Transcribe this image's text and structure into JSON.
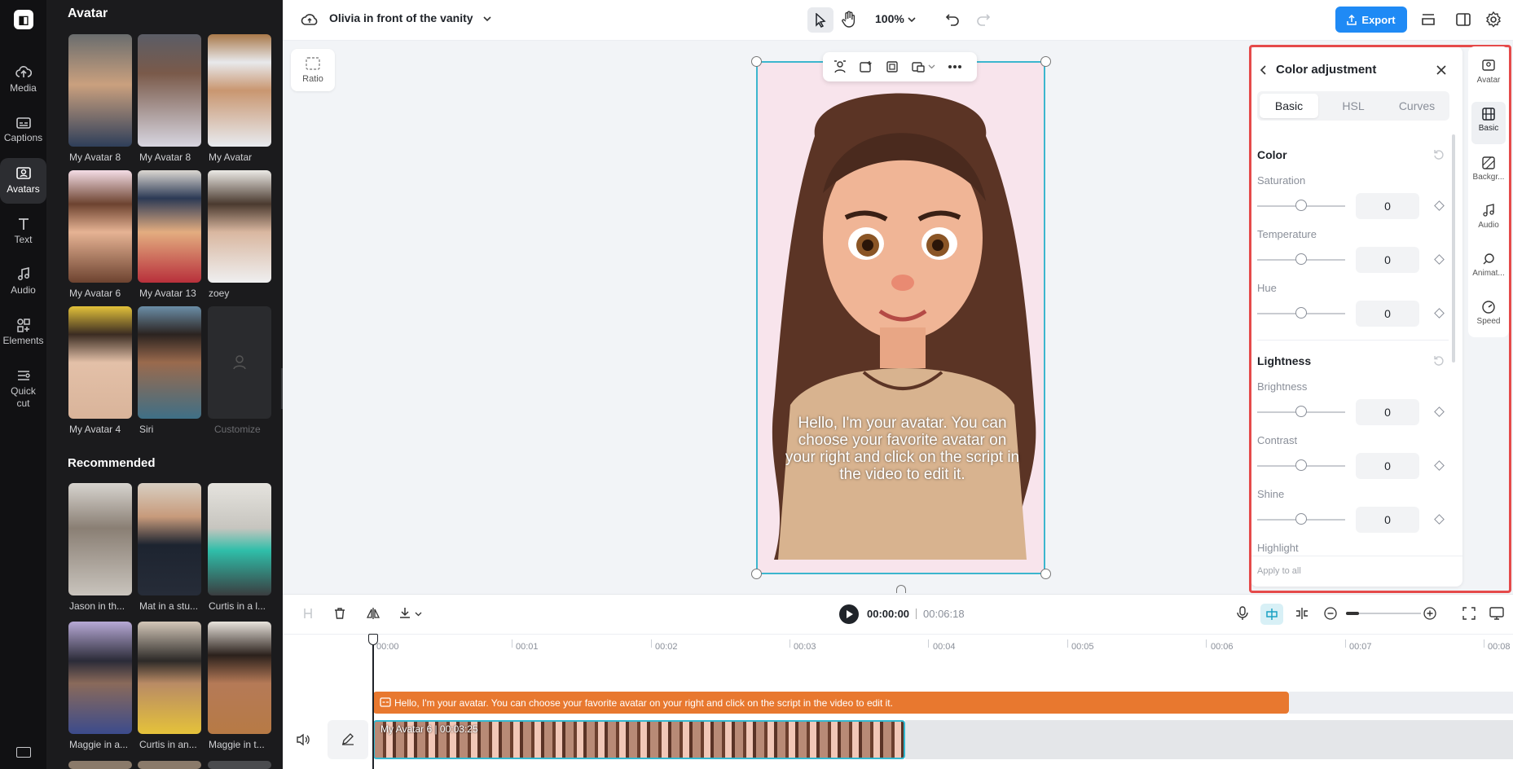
{
  "nav": {
    "items": [
      {
        "label": "Media"
      },
      {
        "label": "Captions"
      },
      {
        "label": "Avatars"
      },
      {
        "label": "Text"
      },
      {
        "label": "Audio"
      },
      {
        "label": "Elements"
      },
      {
        "label": "Quick cut"
      }
    ]
  },
  "panel": {
    "title": "Avatar",
    "avatars": [
      {
        "name": "My Avatar 8"
      },
      {
        "name": "My Avatar 8"
      },
      {
        "name": "My Avatar"
      },
      {
        "name": "My Avatar 6"
      },
      {
        "name": "My Avatar 13"
      },
      {
        "name": "zoey"
      },
      {
        "name": "My Avatar 4"
      },
      {
        "name": "Siri"
      },
      {
        "name": "Customize"
      }
    ],
    "recommended_title": "Recommended",
    "recommended": [
      {
        "name": "Jason in th..."
      },
      {
        "name": "Mat in a stu..."
      },
      {
        "name": "Curtis in a l..."
      },
      {
        "name": "Maggie in a..."
      },
      {
        "name": "Curtis in an..."
      },
      {
        "name": "Maggie in t..."
      }
    ]
  },
  "topbar": {
    "project_title": "Olivia in front of the vanity",
    "zoom": "100%",
    "export_label": "Export"
  },
  "canvas": {
    "ratio_label": "Ratio",
    "caption": "Hello, I'm your avatar. You can choose your favorite avatar on your right and click on the script in the video to edit it."
  },
  "color_panel": {
    "title": "Color adjustment",
    "tabs": [
      "Basic",
      "HSL",
      "Curves"
    ],
    "color_section": "Color",
    "saturation_label": "Saturation",
    "saturation_value": "0",
    "temperature_label": "Temperature",
    "temperature_value": "0",
    "hue_label": "Hue",
    "hue_value": "0",
    "lightness_section": "Lightness",
    "brightness_label": "Brightness",
    "brightness_value": "0",
    "contrast_label": "Contrast",
    "contrast_value": "0",
    "shine_label": "Shine",
    "shine_value": "0",
    "highlight_label": "Highlight",
    "apply_all": "Apply to all"
  },
  "rail": {
    "items": [
      "Avatar",
      "Basic",
      "Backgr...",
      "Audio",
      "Animat...",
      "Speed"
    ]
  },
  "timeline": {
    "current_time": "00:00:00",
    "total_time": "00:06:18",
    "ticks": [
      "00:00",
      "00:01",
      "00:02",
      "00:03",
      "00:04",
      "00:05",
      "00:06",
      "00:07",
      "00:08"
    ],
    "caption_track": "Hello, I'm your avatar. You can choose your favorite avatar on your right and click on the script in the video to edit it.",
    "video_track": "My Avatar 6 | 00:03:25"
  },
  "colors": {
    "accent": "#1f8af5",
    "caption_track": "#e8782f",
    "selection": "#3cb6ce",
    "highlight_frame": "#e54a4a"
  }
}
